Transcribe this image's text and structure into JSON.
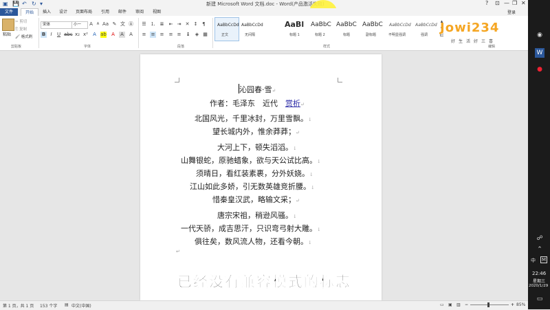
{
  "window": {
    "title": "新建 Microsoft Word 文档.doc - Word(产品激活失败)",
    "help": "?",
    "minimize": "—",
    "restore": "❐",
    "close": "✕"
  },
  "tabs": [
    {
      "label": "文件"
    },
    {
      "label": "开始"
    },
    {
      "label": "插入"
    },
    {
      "label": "设计"
    },
    {
      "label": "页面布局"
    },
    {
      "label": "引用"
    },
    {
      "label": "邮件"
    },
    {
      "label": "审阅"
    },
    {
      "label": "视图"
    }
  ],
  "account": {
    "login": "登录"
  },
  "ribbon": {
    "clipboard": {
      "paste": "粘贴",
      "cut": "剪切",
      "copy": "复制",
      "format_painter": "格式刷",
      "label": "剪贴板"
    },
    "font": {
      "family": "宋体",
      "size": "小一",
      "label": "字体"
    },
    "paragraph": {
      "label": "段落"
    },
    "styles": {
      "label": "样式",
      "items": [
        {
          "sample": "AaBbCcDd",
          "name": "正文"
        },
        {
          "sample": "AaBbCcDd",
          "name": "无间隔"
        },
        {
          "sample": "AaBl",
          "name": "标题 1"
        },
        {
          "sample": "AaBbC",
          "name": "标题 2"
        },
        {
          "sample": "AaBbC",
          "name": "标题"
        },
        {
          "sample": "AaBbC",
          "name": "副标题"
        },
        {
          "sample": "AaBbCcDd",
          "name": "不明显强调"
        },
        {
          "sample": "AaBbCcDd",
          "name": "强调"
        }
      ]
    },
    "editing": {
      "label": "编辑"
    }
  },
  "document": {
    "lines": [
      "沁园春·雪",
      "作者：毛泽东　近代",
      "北国风光，千里冰封，万里雪飘。",
      "望长城内外，惟余莽莽；",
      "大河上下，顿失滔滔。",
      "山舞银蛇，原驰蜡象，欲与天公试比高。",
      "须晴日，看红装素裹，分外妖娆。",
      "江山如此多娇，引无数英雄竞折腰。",
      "惜秦皇汉武，略输文采；",
      "唐宗宋祖，稍逊风骚。",
      "一代天骄，成吉思汗，只识弯弓射大雕。",
      "俱往矣，数风流人物，还看今朝。"
    ],
    "link": "赏析"
  },
  "subtitle": "已经没有兼容模式的标志",
  "status": {
    "page": "第 1 页，共 1 页",
    "words": "153 个字",
    "language": "中文(中国)",
    "zoom": "85%"
  },
  "watermark": {
    "logo": "Jowi234",
    "tagline": "好生活好三喜"
  },
  "taskbar": {
    "lang": "中",
    "ime": "M",
    "time": "22:46",
    "weekday": "星期三",
    "date": "2020/1/29"
  },
  "colors": {
    "accent": "#2b579a",
    "link": "#2e2ea8",
    "subtitle_text": "#000000",
    "watermark": "#f5a623"
  }
}
